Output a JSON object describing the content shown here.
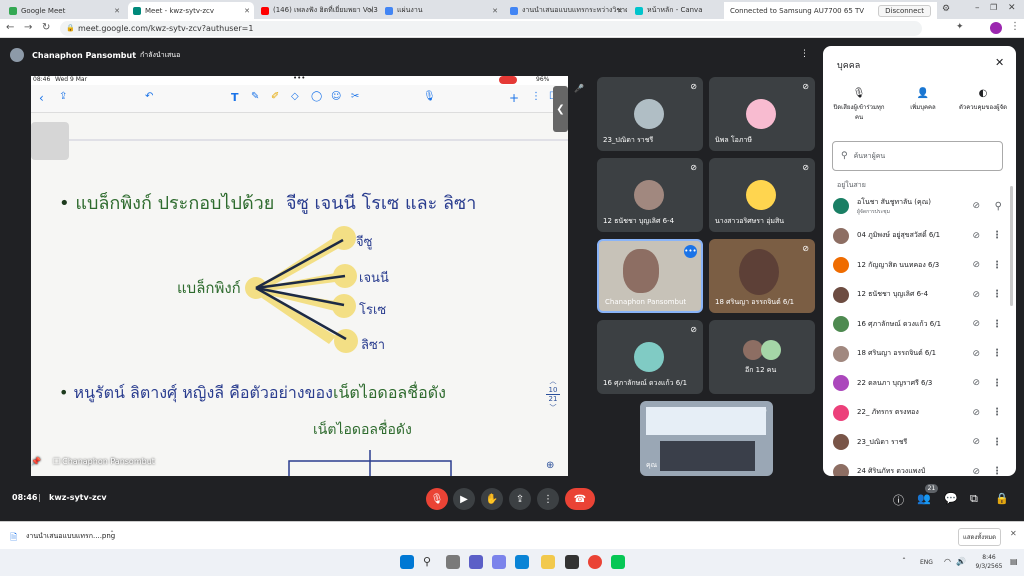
{
  "tabs": [
    {
      "label": "Google Meet",
      "color": "#34a853"
    },
    {
      "label": "Meet - kwz-sytv-zcv",
      "color": "#00897b"
    },
    {
      "label": "(146) เพลงฟัง ฮิตที่เยี่ยมพยา Vol3 | ไ...",
      "color": "#ff0000"
    },
    {
      "label": "แผ่นงาน",
      "color": "#4285f4"
    },
    {
      "label": "งานนำเสนอแบบแทรกระหว่างวิชาดนตรี ภาษ...",
      "color": "#4285f4"
    },
    {
      "label": "หน้าหลัก - Canva",
      "color": "#00c4cc"
    }
  ],
  "cast": {
    "label": "Connected to Samsung AU7700 65 TV",
    "disconnect": "Disconnect"
  },
  "url": "meet.google.com/kwz-sytv-zcv?authuser=1",
  "presenter": {
    "name": "Chanaphon Pansombut",
    "status": "กำลังนำเสนอ"
  },
  "ipad": {
    "time": "08:46",
    "date": "Wed 9 Mar",
    "battery": "96%"
  },
  "slide": {
    "line1_prefix": "แบล็กพิงก์ ประกอบไปด้วย",
    "line1_names": "จีซู เจนนี โรเซ และ ลิซา",
    "center": "แบล็กพิงก์",
    "members": [
      "จีซู",
      "เจนนี",
      "โรเซ",
      "ลิซา"
    ],
    "line2_prefix": "หนูรัตน์ ลิตางศุ์ หญิงลี คือตัวอย่างของ",
    "line2_highlight": "เน็ตไอดอลชื่อดัง",
    "subtitle": "เน็ตไอดอลชื่อดัง",
    "page_current": "10",
    "page_total": "21",
    "presenter_caption": "Chanaphon Pansombut"
  },
  "tiles": [
    {
      "name": "23_ปณิดา ราชรี"
    },
    {
      "name": "นิพล โอภาษี"
    },
    {
      "name": "12 ธนัชชา บุญเลิศ 6-4"
    },
    {
      "name": "นางสาวอริศษรา อุ่มสิน"
    },
    {
      "name": "Chanaphon Pansombut"
    },
    {
      "name": "18 ศรินญา อรรถจินต์ 6/1"
    },
    {
      "name": "16 ศุภาลักษณ์ ดวงแก้ว 6/1"
    },
    {
      "name": "อีก 12 คน"
    },
    {
      "name": "คุณ"
    }
  ],
  "panel": {
    "title": "บุคคล",
    "actions": [
      {
        "label": "ปิดเสียงผู้เข้าร่วมทุกคน"
      },
      {
        "label": "เพิ่มบุคคล"
      },
      {
        "label": "ตัวควบคุมของผู้จัด"
      }
    ],
    "search_placeholder": "ค้นหาผู้คน",
    "section": "อยู่ในสาย",
    "people": [
      {
        "name": "อโนชา สันชูทาลัน (คุณ)",
        "sub": "ผู้จัดการประชุม",
        "color": "#1a7f64"
      },
      {
        "name": "04 ภูมิพงษ์ อยู่สุขสวัสดิ์ 6/1",
        "sub": "",
        "color": "#8d6e63"
      },
      {
        "name": "12 กัญญาสิต นนทคอง 6/3",
        "sub": "",
        "color": "#ef6c00"
      },
      {
        "name": "12 ธนัชชา บุญเลิศ 6-4",
        "sub": "",
        "color": "#6d4c41"
      },
      {
        "name": "16 ศุภาลักษณ์ ดวงแก้ว 6/1",
        "sub": "",
        "color": "#4e8a50"
      },
      {
        "name": "18 ศรินญา อรรถจินต์ 6/1",
        "sub": "",
        "color": "#a1887f"
      },
      {
        "name": "22 ดลนภา บุญราศรี 6/3",
        "sub": "",
        "color": "#ab47bc"
      },
      {
        "name": "22_ ภัทรกร ตรงทอง",
        "sub": "",
        "color": "#ec407a"
      },
      {
        "name": "23_ปณิดา ราชรี",
        "sub": "",
        "color": "#795548"
      },
      {
        "name": "24 ศิรินภัทร ดวงแพงป์",
        "sub": "",
        "color": "#8d6e63"
      }
    ]
  },
  "meeting": {
    "time": "08:46",
    "code": "kwz-sytv-zcv",
    "people_count": "21"
  },
  "download": {
    "file": "งานนำเสนอแบบแทรก....png",
    "show_all": "แสดงทั้งหมด"
  },
  "taskbar": {
    "lang": "ENG",
    "time": "8:46",
    "date": "9/3/2565"
  }
}
